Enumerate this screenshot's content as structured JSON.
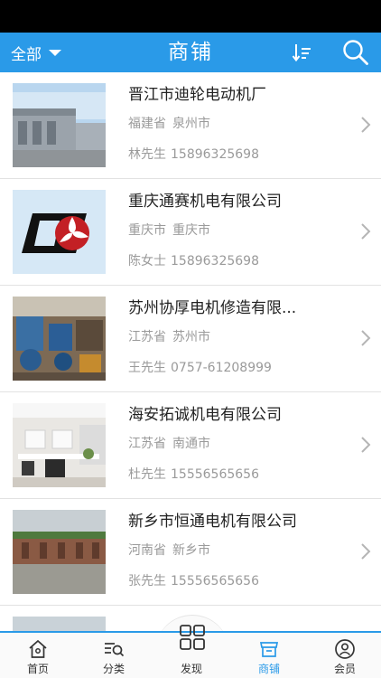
{
  "header": {
    "filter_label": "全部",
    "title": "商铺"
  },
  "shops": [
    {
      "name": "晋江市迪轮电动机厂",
      "province": "福建省",
      "city": "泉州市",
      "contact": "林先生",
      "phone": "15896325698"
    },
    {
      "name": "重庆通赛机电有限公司",
      "province": "重庆市",
      "city": "重庆市",
      "contact": "陈女士",
      "phone": "15896325698"
    },
    {
      "name": "苏州协厚电机修造有限...",
      "province": "江苏省",
      "city": "苏州市",
      "contact": "王先生",
      "phone": "0757-61208999"
    },
    {
      "name": "海安拓诚机电有限公司",
      "province": "江苏省",
      "city": "南通市",
      "contact": "杜先生",
      "phone": "15556565656"
    },
    {
      "name": "新乡市恒通电机有限公司",
      "province": "河南省",
      "city": "新乡市",
      "contact": "张先生",
      "phone": "15556565656"
    }
  ],
  "tabs": [
    {
      "label": "首页",
      "icon": "home-icon"
    },
    {
      "label": "分类",
      "icon": "category-search-icon"
    },
    {
      "label": "发现",
      "icon": "grid-icon"
    },
    {
      "label": "商铺",
      "icon": "shop-icon"
    },
    {
      "label": "会员",
      "icon": "user-icon"
    }
  ],
  "colors": {
    "primary": "#2a9ae8",
    "header_text": "#ffffff",
    "secondary_text": "#9a9a9a"
  }
}
